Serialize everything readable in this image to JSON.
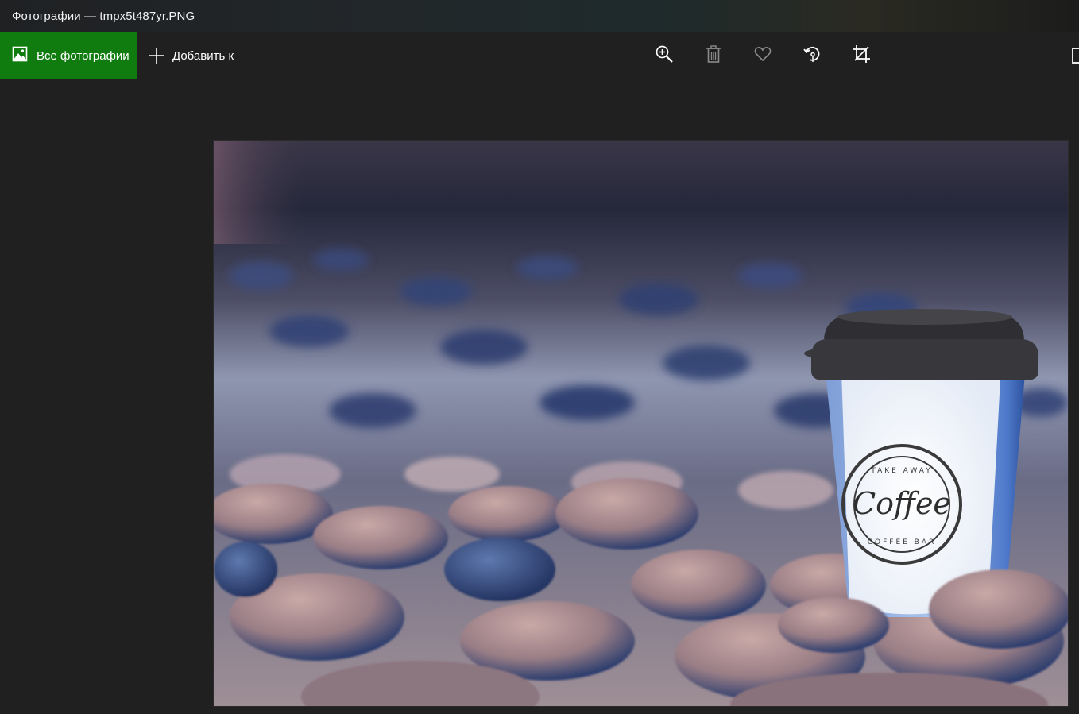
{
  "window": {
    "title": "Фотографии — tmpx5t487yr.PNG"
  },
  "toolbar": {
    "all_photos_label": "Все фотографии",
    "add_to_label": "Добавить к",
    "tools": [
      "zoom-in-icon",
      "trash-icon",
      "heart-icon",
      "rotate-icon",
      "crop-icon"
    ]
  },
  "photo": {
    "cup_logo_text": "Coffee",
    "cup_logo_top": "TAKE AWAY",
    "cup_logo_bottom": "COFFEE BAR"
  },
  "colors": {
    "accent": "#107c10",
    "background": "#202020"
  }
}
